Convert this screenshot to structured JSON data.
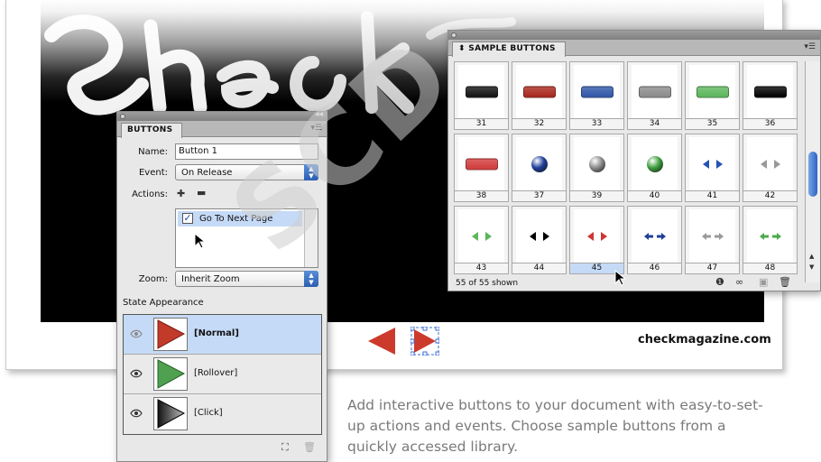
{
  "document": {
    "url_text": "checkmagazine.com",
    "caption": "Add interactive buttons to your document with easy-to-set-up actions and events. Choose sample buttons from a quickly accessed library."
  },
  "watermark": "SCD",
  "buttons_panel": {
    "tab": "BUTTONS",
    "name_label": "Name:",
    "name_value": "Button 1",
    "event_label": "Event:",
    "event_value": "On Release",
    "actions_label": "Actions:",
    "add_action_icon": "add-action-icon",
    "remove_action_icon": "remove-action-icon",
    "actions": [
      {
        "label": "Go To Next Page",
        "checked": true
      }
    ],
    "zoom_label": "Zoom:",
    "zoom_value": "Inherit Zoom",
    "state_heading": "State Appearance",
    "states": [
      {
        "label": "[Normal]",
        "color": "#c23a2a",
        "selected": true
      },
      {
        "label": "[Rollover]",
        "color": "#4fa14f",
        "selected": false
      },
      {
        "label": "[Click]",
        "color": "#222222",
        "selected": false
      }
    ]
  },
  "sample_panel": {
    "tab": "SAMPLE BUTTONS",
    "status": "55 of 55 shown",
    "buttons": [
      {
        "num": "31",
        "kind": "pill",
        "color": "#111111"
      },
      {
        "num": "32",
        "kind": "pill",
        "color": "#a8261b"
      },
      {
        "num": "33",
        "kind": "pill",
        "color": "#2f56a8"
      },
      {
        "num": "34",
        "kind": "pill",
        "color": "#8a8a8a"
      },
      {
        "num": "35",
        "kind": "pill",
        "color": "#5bb65b"
      },
      {
        "num": "36",
        "kind": "pill",
        "color": "#000000"
      },
      {
        "num": "38",
        "kind": "pill",
        "color": "#d13a3a"
      },
      {
        "num": "37",
        "kind": "orb",
        "color": "#1f3f9a"
      },
      {
        "num": "39",
        "kind": "orb",
        "color": "#8c8c8c"
      },
      {
        "num": "40",
        "kind": "orb",
        "color": "#3e9e3e"
      },
      {
        "num": "41",
        "kind": "triangles",
        "color": "#2553b5"
      },
      {
        "num": "42",
        "kind": "triangles",
        "color": "#999999"
      },
      {
        "num": "43",
        "kind": "triangles",
        "color": "#5bb65b"
      },
      {
        "num": "44",
        "kind": "triangles",
        "color": "#000000"
      },
      {
        "num": "45",
        "kind": "triangles",
        "color": "#d03434",
        "highlighted": true
      },
      {
        "num": "46",
        "kind": "arrows",
        "color": "#1f3f9a"
      },
      {
        "num": "47",
        "kind": "arrows",
        "color": "#999999"
      },
      {
        "num": "48",
        "kind": "arrows",
        "color": "#4caa4c"
      }
    ]
  }
}
